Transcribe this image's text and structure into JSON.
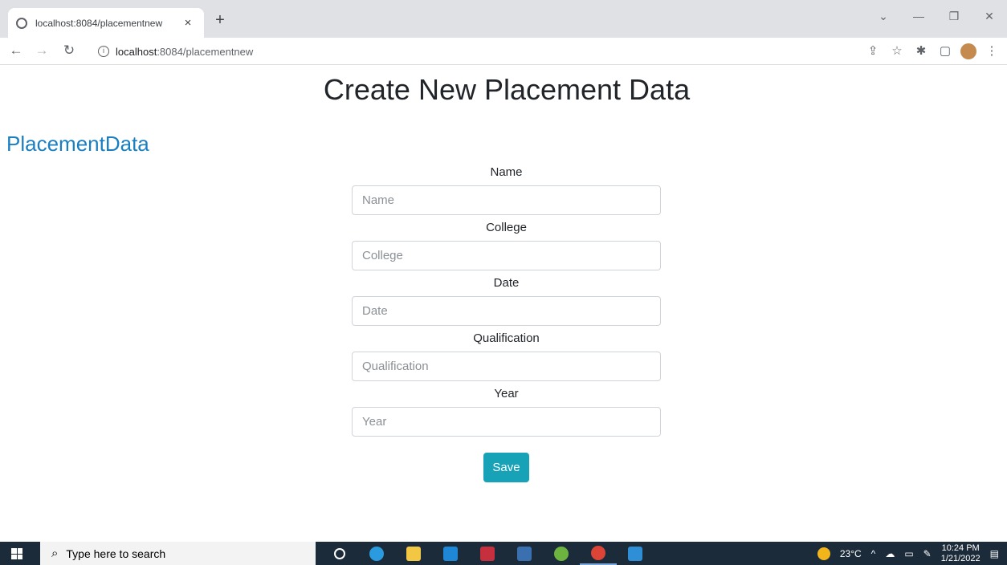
{
  "browser": {
    "tab_title": "localhost:8084/placementnew",
    "tab_close": "×",
    "new_tab": "+",
    "url_host": "localhost",
    "url_path": ":8084/placementnew"
  },
  "page": {
    "heading": "Create New Placement Data",
    "brand": "PlacementData"
  },
  "form": {
    "fields": [
      {
        "label": "Name",
        "placeholder": "Name"
      },
      {
        "label": "College",
        "placeholder": "College"
      },
      {
        "label": "Date",
        "placeholder": "Date"
      },
      {
        "label": "Qualification",
        "placeholder": "Qualification"
      },
      {
        "label": "Year",
        "placeholder": "Year"
      }
    ],
    "save_label": "Save",
    "save_color": "#17a2b8"
  },
  "taskbar": {
    "search_placeholder": "Type here to search",
    "weather": "23°C",
    "time": "10:24 PM",
    "date": "1/21/2022"
  },
  "colors": {
    "brand": "#1a7fc1",
    "taskbar": "#1c2b3a"
  }
}
